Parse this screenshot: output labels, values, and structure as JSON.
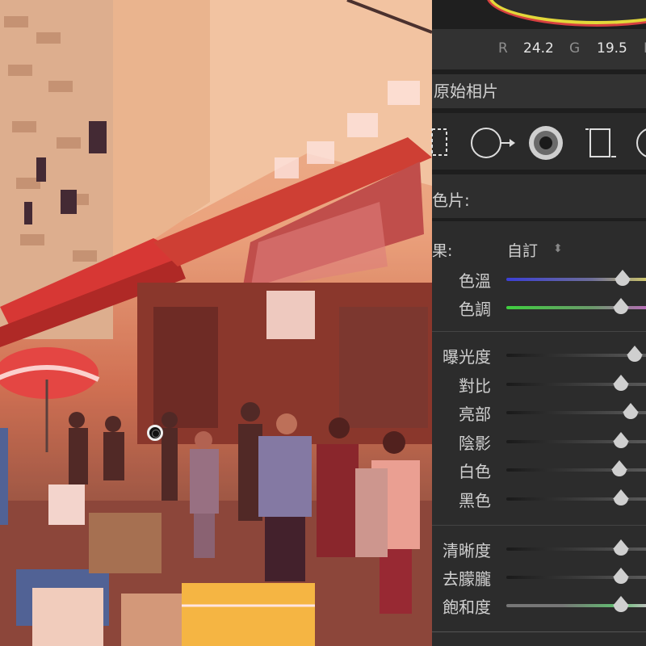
{
  "readout": {
    "r_label": "R",
    "r_value": "24.2",
    "g_label": "G",
    "g_value": "19.5",
    "b_label": "B"
  },
  "panel": {
    "profile_label": "原始相片",
    "tools": [
      {
        "icon": "crop-overlay-icon"
      },
      {
        "icon": "spot-removal-icon"
      },
      {
        "icon": "red-eye-icon"
      },
      {
        "icon": "graduated-filter-icon"
      },
      {
        "icon": "radial-filter-icon"
      }
    ],
    "color_label": "色片:",
    "wb_label": "果:",
    "wb_value": "自訂",
    "wb_arrow": "⬍",
    "sliders_wb": [
      {
        "label": "色溫",
        "level": 0.82
      },
      {
        "label": "色調",
        "level": 0.81
      }
    ],
    "sliders_tone": [
      {
        "label": "曝光度",
        "level": 0.91
      },
      {
        "label": "對比",
        "level": 0.81
      },
      {
        "label": "亮部",
        "level": 0.88
      },
      {
        "label": "陰影",
        "level": 0.81
      },
      {
        "label": "白色",
        "level": 0.8
      },
      {
        "label": "黑色",
        "level": 0.81
      }
    ],
    "sliders_presence": [
      {
        "label": "清晰度",
        "level": 0.81
      },
      {
        "label": "去朦朧",
        "level": 0.81
      },
      {
        "label": "飽和度",
        "level": 0.81
      }
    ]
  },
  "colors": {
    "panel_bg": "#2c2c2c",
    "accent_yellow": "#e3d83a",
    "accent_red": "#d64040"
  }
}
